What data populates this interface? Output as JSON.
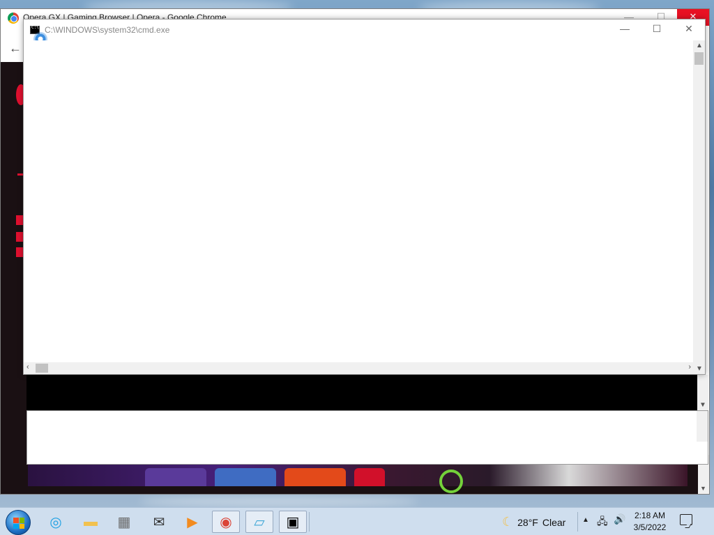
{
  "chrome_window": {
    "title": "Opera GX | Gaming Browser | Opera - Google Chrome",
    "close_glyph": "✕",
    "maximize_glyph": "☐",
    "minimize_glyph": "—",
    "back_glyph": "←"
  },
  "cmd_window": {
    "title": "C:\\WINDOWS\\system32\\cmd.exe",
    "minimize_glyph": "—",
    "maximize_glyph": "☐",
    "close_glyph": "✕"
  },
  "taskbar": {
    "apps": [
      {
        "name": "edge-icon",
        "glyph": "◎",
        "color": "#1fa1e3"
      },
      {
        "name": "file-explorer-icon",
        "glyph": "▬",
        "color": "#f2c14e"
      },
      {
        "name": "microsoft-store-icon",
        "glyph": "▦",
        "color": "#6a6a6a"
      },
      {
        "name": "mail-icon",
        "glyph": "✉",
        "color": "#333333"
      },
      {
        "name": "media-player-icon",
        "glyph": "▶",
        "color": "#f28b1f"
      },
      {
        "name": "chrome-icon",
        "glyph": "◉",
        "color": "#db4437"
      },
      {
        "name": "notepad-icon",
        "glyph": "▱",
        "color": "#3fa7d6"
      },
      {
        "name": "cmd-icon",
        "glyph": "▣",
        "color": "#000000"
      }
    ],
    "weather": {
      "temperature": "28°F",
      "condition": "Clear",
      "icon": "moon-icon"
    },
    "clock": {
      "time": "2:18 AM",
      "date": "3/5/2022"
    }
  },
  "colors": {
    "opera_red": "#e0102f",
    "chrome_close": "#e81123",
    "taskbar": "#d2e1f0"
  }
}
